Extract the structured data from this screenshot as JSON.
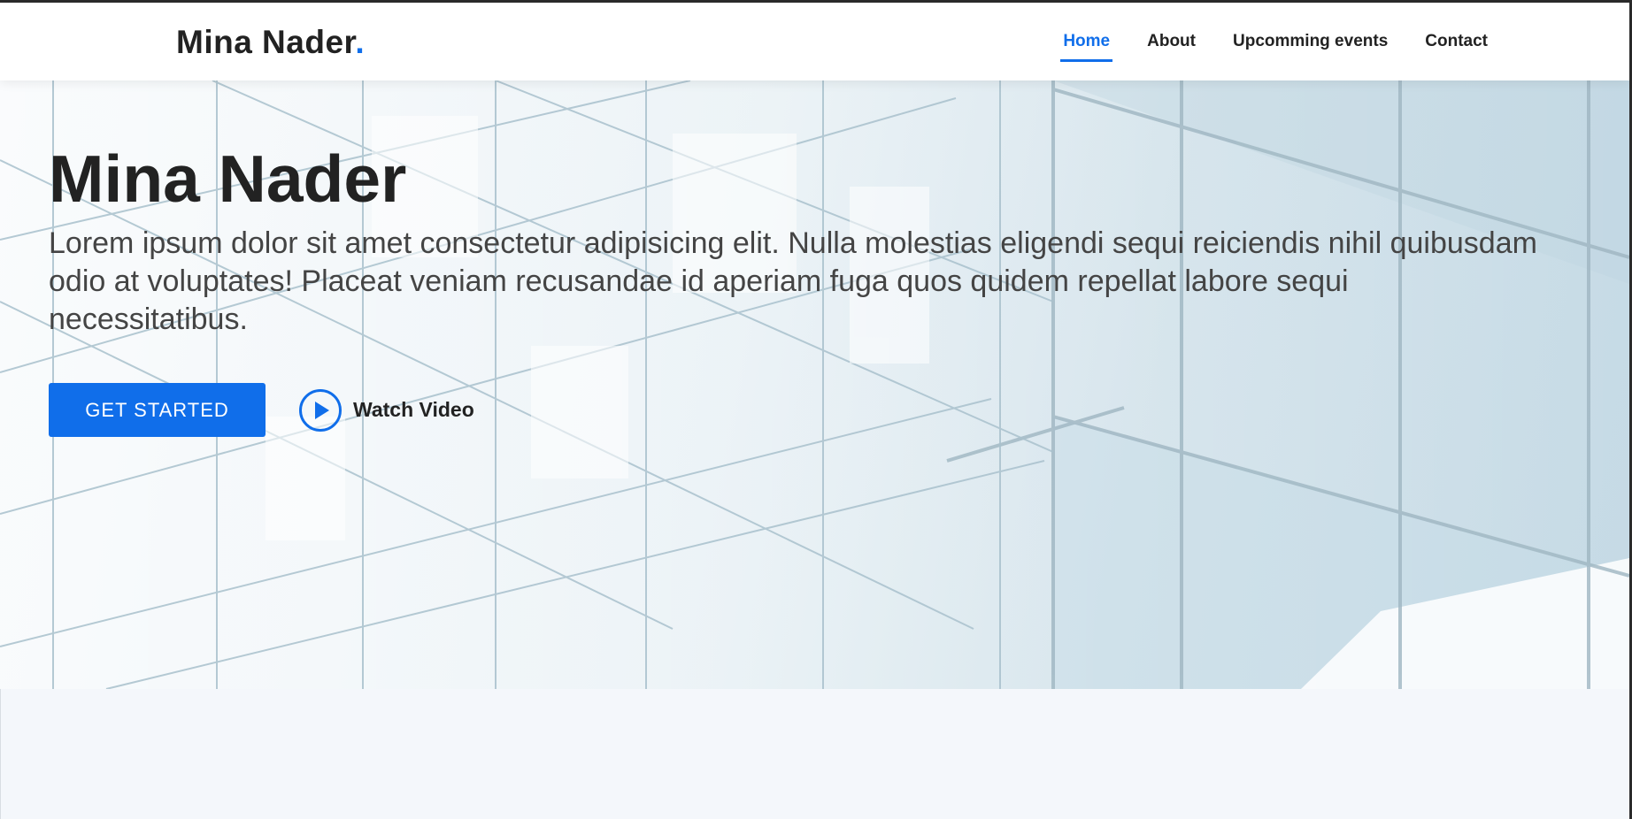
{
  "header": {
    "logo_text": "Mina Nader",
    "logo_dot": ".",
    "nav": [
      {
        "label": "Home",
        "active": true
      },
      {
        "label": "About",
        "active": false
      },
      {
        "label": "Upcomming events",
        "active": false
      },
      {
        "label": "Contact",
        "active": false
      }
    ]
  },
  "hero": {
    "title": "Mina Nader",
    "text": "Lorem ipsum dolor sit amet consectetur adipisicing elit. Nulla molestias eligendi sequi reiciendis nihil quibusdam odio at voluptates! Placeat veniam recusandae id aperiam fuga quos quidem repellat labore sequi necessitatibus.",
    "cta_label": "GET STARTED",
    "video_label": "Watch Video",
    "play_icon": "play-icon"
  },
  "colors": {
    "accent": "#106eea",
    "text_dark": "#222222",
    "text_body": "#444444"
  }
}
